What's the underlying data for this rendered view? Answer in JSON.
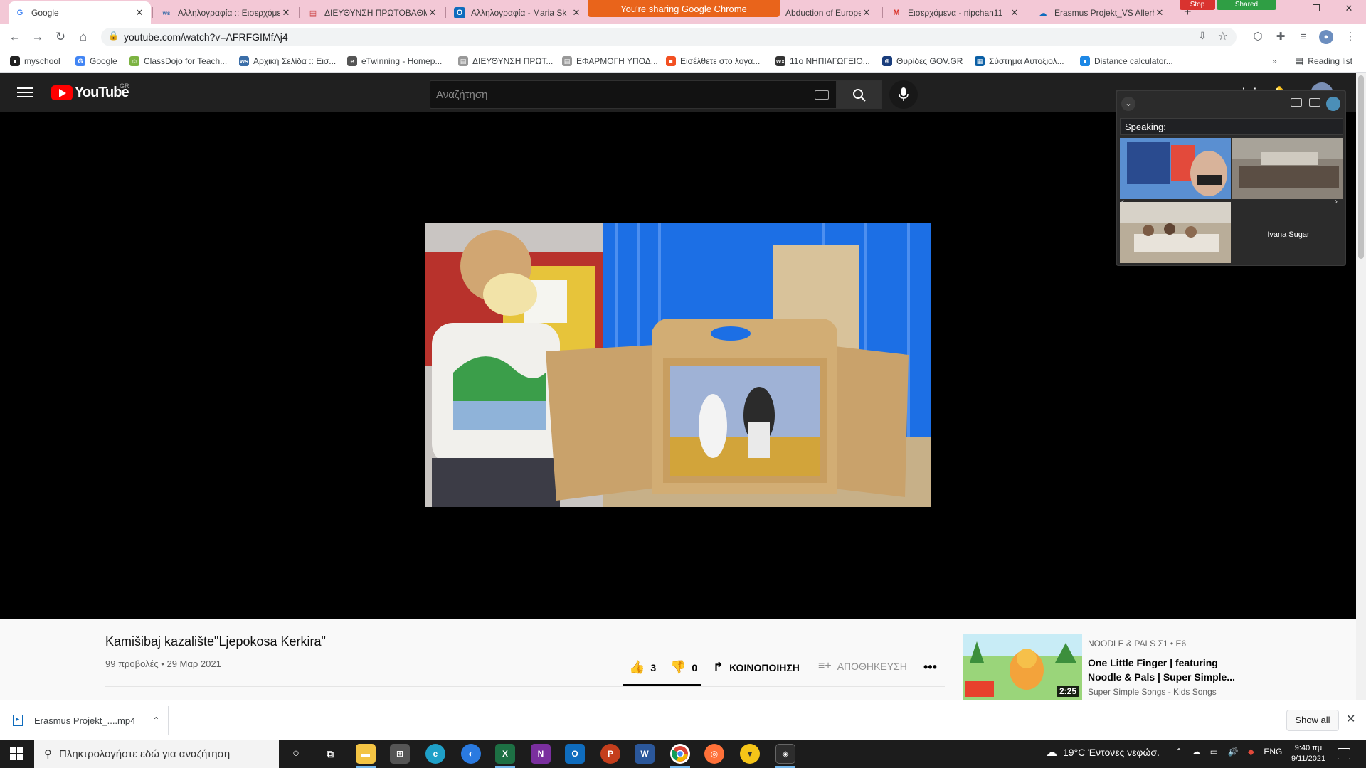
{
  "browser": {
    "tabs": [
      {
        "title": "Google",
        "favicon": "G",
        "color": "#4285f4"
      },
      {
        "title": "Αλληλογραφία :: Εισερχόμενα",
        "favicon": "ws",
        "color": "#3b6ea8"
      },
      {
        "title": "ΔΙΕΥΘΥΝΣΗ ΠΡΩΤΟΒΑΘΜΙΑΣ",
        "favicon": "▤",
        "color": "#c44"
      },
      {
        "title": "Αλληλογραφία - Maria Sk",
        "favicon": "O",
        "color": "#0f6cbd"
      },
      {
        "title": "Abduction of Europe",
        "favicon": "",
        "color": "#888"
      },
      {
        "title": "Εισερχόμενα - nipchan11",
        "favicon": "M",
        "color": "#d93025"
      },
      {
        "title": "Erasmus Projekt_VS Allerh",
        "favicon": "☁",
        "color": "#0f6cbd"
      }
    ],
    "share_banner": "You're sharing Google Chrome",
    "stop_label": "Stop",
    "shared_label": "Shared",
    "url": "youtube.com/watch?v=AFRFGIMfAj4",
    "bookmarks": [
      {
        "label": "myschool",
        "icon": "●",
        "color": "#222"
      },
      {
        "label": "Google",
        "icon": "G",
        "color": "#4285f4"
      },
      {
        "label": "ClassDojo for Teach...",
        "icon": "☺",
        "color": "#7cb342"
      },
      {
        "label": "Αρχική Σελίδα :: Εισ...",
        "icon": "ws",
        "color": "#3b6ea8"
      },
      {
        "label": "eTwinning - Homep...",
        "icon": "e",
        "color": "#555"
      },
      {
        "label": "ΔΙΕΥΘΥΝΣΗ ΠΡΩΤ...",
        "icon": "▤",
        "color": "#999"
      },
      {
        "label": "ΕΦΑΡΜΟΓΗ ΥΠΟΔ...",
        "icon": "▤",
        "color": "#999"
      },
      {
        "label": "Εισέλθετε στο λογα...",
        "icon": "■",
        "color": "#f25022"
      },
      {
        "label": "11ο ΝΗΠΙΑΓΩΓΕΙΟ...",
        "icon": "wx",
        "color": "#333"
      },
      {
        "label": "Θυρίδες GOV.GR",
        "icon": "⊕",
        "color": "#1a3d7c"
      },
      {
        "label": "Σύστημα Αυτοξιολ...",
        "icon": "▦",
        "color": "#0b5fa5"
      },
      {
        "label": "Distance calculator...",
        "icon": "●",
        "color": "#1e88e5"
      }
    ],
    "reading_list": "Reading list"
  },
  "youtube": {
    "logo_text": "YouTube",
    "region": "GR",
    "search_placeholder": "Αναζήτηση",
    "video": {
      "title": "Kamišibaj kazalište\"Ljepokosa Kerkira\"",
      "meta": "99 προβολές • 29 Μαρ 2021",
      "likes": "3",
      "dislikes": "0",
      "share_label": "ΚΟΙΝΟΠΟΙΗΣΗ",
      "save_label": "ΑΠΟΘΗΚΕΥΣΗ"
    },
    "recommendation": {
      "channel_tag": "NOODLE & PALS  Σ1 • Ε6",
      "title": "One Little Finger | featuring Noodle & Pals | Super Simple...",
      "channel": "Super Simple Songs - Kids Songs",
      "duration": "2:25"
    }
  },
  "meet": {
    "speaking_label": "Speaking:",
    "participant_name": "Ivana Sugar"
  },
  "downloads": {
    "file": "Erasmus Projekt_....mp4",
    "show_all": "Show all"
  },
  "taskbar": {
    "search_placeholder": "Πληκτρολογήστε εδώ για αναζήτηση",
    "weather": "19°C  Έντονες νεφώσ.",
    "language": "ENG",
    "time": "9:40 πμ",
    "date": "9/11/2021"
  }
}
